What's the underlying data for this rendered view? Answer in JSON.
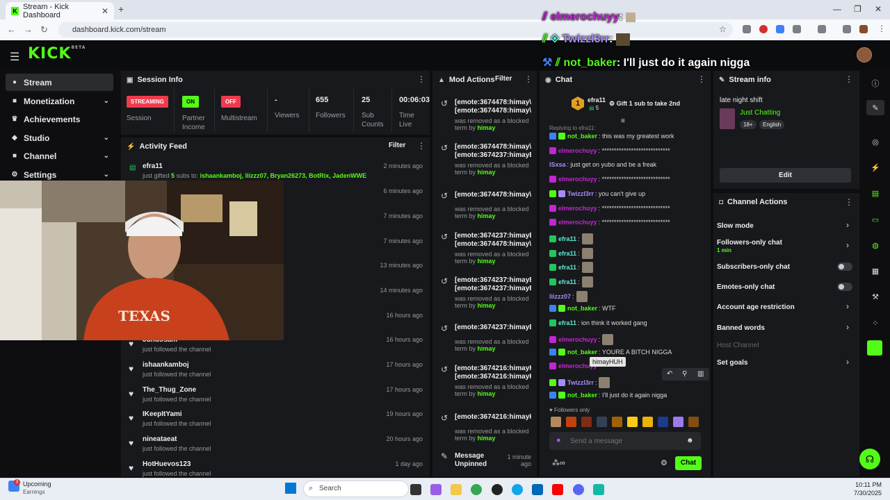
{
  "browser": {
    "tab_title": "Stream - Kick Dashboard",
    "tab_favicon": "K",
    "url": "dashboard.kick.com/stream",
    "new_tab": "+"
  },
  "overlay": [
    {
      "user": "elmerochuyy",
      "text": ":",
      "color": "#c026d3"
    },
    {
      "user": "Twizzl3rr",
      "text": ":",
      "color": "#a78bfa"
    },
    {
      "user": "not_baker",
      "text": ": I'll just do it again nigga",
      "color": "#53fc18"
    }
  ],
  "header": {
    "logo": "KICK",
    "logo_sup": "BETA"
  },
  "nav": [
    {
      "label": "Stream",
      "icon": "stream-icon",
      "glyph": "●"
    },
    {
      "label": "Monetization",
      "icon": "monetization-icon",
      "glyph": "■",
      "chev": "⌄"
    },
    {
      "label": "Achievements",
      "icon": "trophy-icon",
      "glyph": "♛"
    },
    {
      "label": "Studio",
      "icon": "studio-icon",
      "glyph": "◆",
      "chev": "⌄"
    },
    {
      "label": "Channel",
      "icon": "channel-icon",
      "glyph": "■",
      "chev": "⌄"
    },
    {
      "label": "Settings",
      "icon": "settings-icon",
      "glyph": "⚙",
      "chev": "⌄"
    }
  ],
  "session": {
    "title": "Session Info",
    "streaming_badge": "STREAMING",
    "session_label": "Session",
    "on_badge": "ON",
    "partner_label": "Partner Income",
    "off_badge": "OFF",
    "multistream_label": "Multistream",
    "viewers_value": "-",
    "viewers_label": "Viewers",
    "followers_value": "655",
    "followers_label": "Followers",
    "subs_value": "25",
    "subs_label": "Sub Counts",
    "time_value": "00:06:03",
    "time_label": "Time Live"
  },
  "activity": {
    "title": "Activity Feed",
    "filter": "Filter",
    "first": {
      "name": "efra11",
      "pre": "just gifted ",
      "count": "5",
      "mid": " subs to: ",
      "recipients": "ishaankamboj, liizzz07, Bryan26273, BotRix, JadenWWE",
      "time": "2 minutes ago"
    },
    "times": [
      "6 minutes ago",
      "7 minutes ago",
      "7 minutes ago",
      "13 minutes ago",
      "14 minutes ago",
      "16 hours ago"
    ],
    "items": [
      {
        "name": "Jdndosam",
        "sub": "just followed the channel",
        "time": "16 hours ago"
      },
      {
        "name": "ishaankamboj",
        "sub": "just followed the channel",
        "time": "17 hours ago"
      },
      {
        "name": "The_Thug_Zone",
        "sub": "just followed the channel",
        "time": "17 hours ago"
      },
      {
        "name": "IKeepItYami",
        "sub": "just followed the channel",
        "time": "19 hours ago"
      },
      {
        "name": "nineataeat",
        "sub": "just followed the channel",
        "time": "20 hours ago"
      },
      {
        "name": "HotHuevos123",
        "sub": "just followed the channel",
        "time": "1 day ago"
      }
    ]
  },
  "mod": {
    "title": "Mod Actions",
    "filter": "Filter",
    "entries": [
      {
        "l1": "[emote:3674478:himay\\",
        "l2": "[emote:3674478:himay\\",
        "s1": "was removed as a blocked",
        "s2": "term by ",
        "by": "himay"
      },
      {
        "l1": "[emote:3674478:himay\\",
        "l2": "[emote:3674237:himayE",
        "s1": "was removed as a blocked",
        "s2": "term by ",
        "by": "himay"
      },
      {
        "l1": "[emote:3674478:himay\\",
        "l2": "",
        "s1": "was removed as a blocked",
        "s2": "term by ",
        "by": "himay"
      },
      {
        "l1": "[emote:3674237:himayE",
        "l2": "[emote:3674478:himay\\",
        "s1": "was removed as a blocked",
        "s2": "term by ",
        "by": "himay"
      },
      {
        "l1": "[emote:3674237:himayE",
        "l2": "[emote:3674237:himayE",
        "s1": "was removed as a blocked",
        "s2": "term by ",
        "by": "himay"
      },
      {
        "l1": "[emote:3674237:himayE",
        "l2": "",
        "s1": "was removed as a blocked",
        "s2": "term by ",
        "by": "himay"
      },
      {
        "l1": "[emote:3674216:himayH",
        "l2": "[emote:3674216:himayH",
        "s1": "was removed as a blocked",
        "s2": "term by ",
        "by": "himay"
      },
      {
        "l1": "[emote:3674216:himayH",
        "l2": "",
        "s1": "was removed as a blocked",
        "s2": "term by ",
        "by": "himay"
      }
    ],
    "last": {
      "l1": "Message",
      "l2": "Unpinned",
      "time1": "1 minute",
      "time2": "ago"
    }
  },
  "chat": {
    "title": "Chat",
    "pinned_rank": "1",
    "pinned_user": "efra11",
    "pinned_count": "5",
    "pinned_text": "Gift 1 sub to take 2nd",
    "replying": "Replying to efra11:",
    "lines": [
      {
        "user": "not_baker",
        "color": "#53fc18",
        "text": ": this was my greatest work",
        "badges": [
          "#3b82f6",
          "#53fc18"
        ]
      },
      {
        "user": "elmerochuyy",
        "color": "#c026d3",
        "text": ": ****************************",
        "badges": [
          "#c026d3"
        ]
      },
      {
        "user": "lSxsa",
        "color": "#a78bfa",
        "text": ": just get on yubo and be a freak",
        "badges": []
      },
      {
        "user": "elmerochuyy",
        "color": "#c026d3",
        "text": ": ****************************",
        "badges": [
          "#c026d3"
        ]
      },
      {
        "user": "Twizzl3rr",
        "color": "#a78bfa",
        "text": ": you can't give up",
        "badges": [
          "#53fc18",
          "#a78bfa"
        ]
      },
      {
        "user": "elmerochuyy",
        "color": "#c026d3",
        "text": ": ****************************",
        "badges": [
          "#c026d3"
        ]
      },
      {
        "user": "elmerochuyy",
        "color": "#c026d3",
        "text": ": ****************************",
        "badges": [
          "#c026d3"
        ]
      },
      {
        "user": "efra11",
        "color": "#5eead4",
        "text": ":",
        "badges": [
          "#22c55e"
        ],
        "emote": true
      },
      {
        "user": "efra11",
        "color": "#5eead4",
        "text": ":",
        "badges": [
          "#22c55e"
        ],
        "emote": true
      },
      {
        "user": "efra11",
        "color": "#5eead4",
        "text": ":",
        "badges": [
          "#22c55e"
        ],
        "emote": true
      },
      {
        "user": "efra11",
        "color": "#5eead4",
        "text": ":",
        "badges": [
          "#22c55e"
        ],
        "emote": true
      },
      {
        "user": "liizzz07",
        "color": "#a78bfa",
        "text": ":",
        "badges": [],
        "emote": true
      },
      {
        "user": "not_baker",
        "color": "#53fc18",
        "text": ": WTF",
        "badges": [
          "#3b82f6",
          "#53fc18"
        ]
      },
      {
        "user": "efra11",
        "color": "#5eead4",
        "text": ": ion think it worked gang",
        "badges": [
          "#22c55e"
        ]
      },
      {
        "user": "elmerochuyy",
        "color": "#c026d3",
        "text": ":",
        "badges": [
          "#c026d3"
        ],
        "emote": true
      },
      {
        "user": "not_baker",
        "color": "#53fc18",
        "text": ": YOURE A BITCH NIGGA",
        "badges": [
          "#3b82f6",
          "#53fc18"
        ]
      },
      {
        "user": "elmerochuyy",
        "color": "#c026d3",
        "text": "",
        "badges": [
          "#c026d3"
        ]
      },
      {
        "user": "Twizzl3rr",
        "color": "#a78bfa",
        "text": ":",
        "badges": [
          "#53fc18",
          "#a78bfa"
        ],
        "emote": true
      },
      {
        "user": "not_baker",
        "color": "#53fc18",
        "text": ": I'll just do it again nigga",
        "badges": [
          "#3b82f6",
          "#53fc18"
        ]
      }
    ],
    "tooltip": "himayHUH",
    "followers_only": "Followers only",
    "placeholder": "Send a message",
    "send_button": "Chat"
  },
  "stream_info": {
    "title": "Stream info",
    "stream_title": "late night shift",
    "category": "Just Chatting",
    "tag1": "18+",
    "tag2": "English",
    "edit_button": "Edit"
  },
  "channel_actions": {
    "title": "Channel Actions",
    "slow": "Slow mode",
    "followers_only": "Followers-only chat",
    "followers_sub": "1 min",
    "subs_only": "Subscribers-only chat",
    "emotes_only": "Emotes-only chat",
    "account_age": "Account age restriction",
    "banned": "Banned words",
    "host": "Host Channel",
    "goals": "Set goals"
  },
  "taskbar": {
    "notif_count": "3",
    "widget_title": "Upcoming",
    "widget_sub": "Earnings",
    "search": "Search",
    "time": "10:11 PM",
    "date": "7/30/2025"
  },
  "colors": {
    "kick_green": "#53fc18",
    "panel": "#18191c",
    "bg": "#0e0e10"
  }
}
